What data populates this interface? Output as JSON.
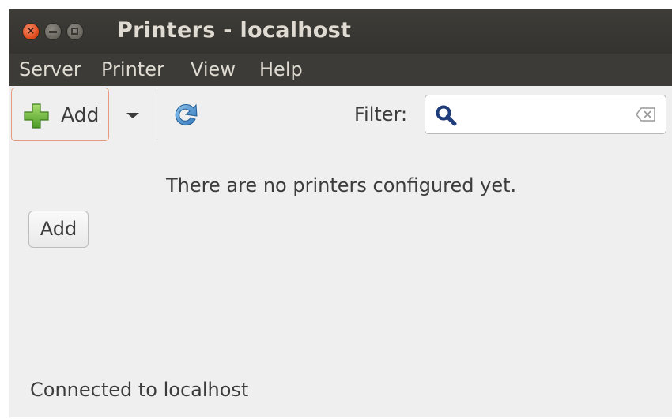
{
  "window": {
    "title": "Printers - localhost",
    "close_glyph": "×"
  },
  "menubar": {
    "items": [
      {
        "label": "Server"
      },
      {
        "label": "Printer"
      },
      {
        "label": "View"
      },
      {
        "label": "Help"
      }
    ]
  },
  "toolbar": {
    "add_label": "Add",
    "add_icon": "plus-icon",
    "dropdown_icon": "chevron-down-icon",
    "refresh_icon": "refresh-icon",
    "filter_label": "Filter:",
    "filter_value": "",
    "search_icon": "search-icon",
    "clear_icon": "clear-icon"
  },
  "main": {
    "empty_message": "There are no printers configured yet.",
    "add_button_label": "Add"
  },
  "status": {
    "text": "Connected to localhost"
  },
  "colors": {
    "titlebar": "#3c3b37",
    "window_bg": "#efefef",
    "close_button": "#df4b1b",
    "accent_green": "#6fb83a",
    "refresh_blue": "#3d86c6"
  }
}
